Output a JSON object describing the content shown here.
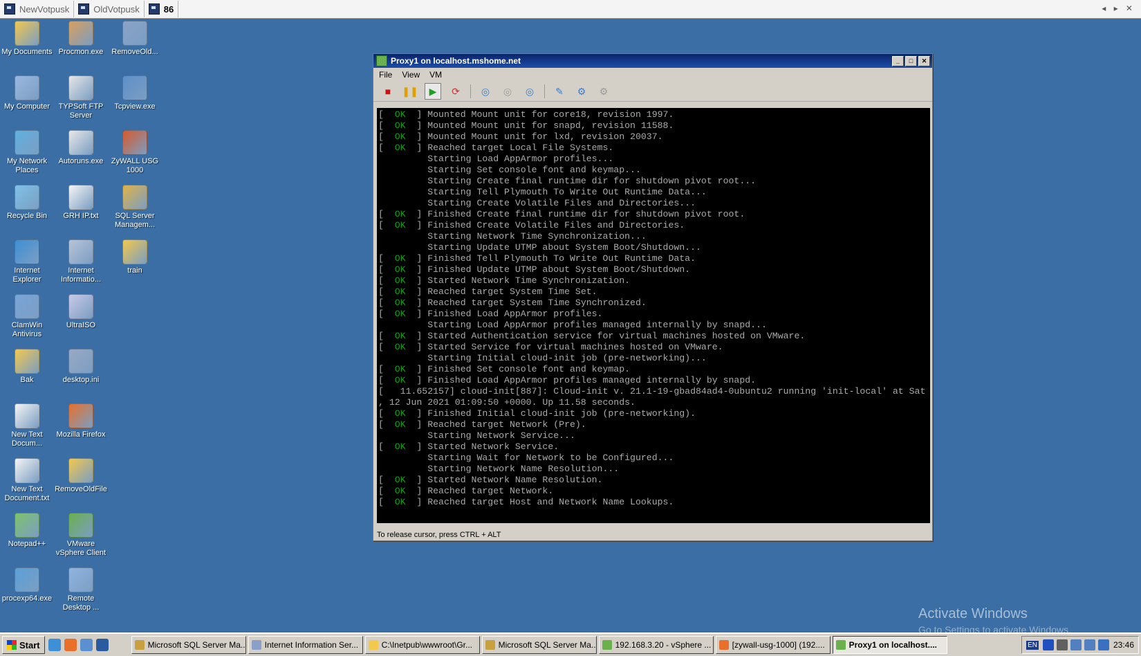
{
  "tabs": [
    {
      "label": "NewVotpusk",
      "active": false
    },
    {
      "label": "OldVotpusk",
      "active": false
    },
    {
      "label": "86",
      "active": true
    }
  ],
  "desktop_icons": [
    {
      "label": "My Documents",
      "icon": "folder-docs-icon",
      "color": "#f2c94c"
    },
    {
      "label": "Procmon.exe",
      "icon": "procmon-icon",
      "color": "#d9a05b"
    },
    {
      "label": "RemoveOld...",
      "icon": "remove-old-icon",
      "color": "#8aa3c8"
    },
    {
      "label": "My Computer",
      "icon": "computer-icon",
      "color": "#9bb7e0"
    },
    {
      "label": "TYPSoft FTP Server",
      "icon": "ftp-icon",
      "color": "#e6e6e6"
    },
    {
      "label": "Tcpview.exe",
      "icon": "tcpview-icon",
      "color": "#5f8fc9"
    },
    {
      "label": "My Network Places",
      "icon": "network-icon",
      "color": "#5fb0e0"
    },
    {
      "label": "Autoruns.exe",
      "icon": "autoruns-icon",
      "color": "#e8e8e8"
    },
    {
      "label": "ZyWALL USG 1000",
      "icon": "firefox-shortcut-icon",
      "color": "#d65a2a"
    },
    {
      "label": "Recycle Bin",
      "icon": "recycle-bin-icon",
      "color": "#7fc2e8"
    },
    {
      "label": "GRH IP.txt",
      "icon": "text-file-icon",
      "color": "#f5f5f5"
    },
    {
      "label": "SQL Server Managem...",
      "icon": "sql-server-icon",
      "color": "#e0b34a"
    },
    {
      "label": "Internet Explorer",
      "icon": "ie-icon",
      "color": "#3d8fd6"
    },
    {
      "label": "Internet Informatio...",
      "icon": "iis-icon",
      "color": "#b8c4d8"
    },
    {
      "label": "train",
      "icon": "folder-icon",
      "color": "#f2c94c"
    },
    {
      "label": "ClamWin Antivirus",
      "icon": "clamwin-icon",
      "color": "#7aa5d8"
    },
    {
      "label": "UltraISO",
      "icon": "ultraiso-icon",
      "color": "#c9c9e8"
    },
    {
      "label": "Bak",
      "icon": "folder-icon",
      "color": "#f2c94c"
    },
    {
      "label": "desktop.ini",
      "icon": "ini-file-icon",
      "color": "#9aa9c4"
    },
    {
      "label": "New Text Docum...",
      "icon": "text-file-icon",
      "color": "#f5f5f5"
    },
    {
      "label": "Mozilla Firefox",
      "icon": "firefox-icon",
      "color": "#e8702a"
    },
    {
      "label": "New Text Document.txt",
      "icon": "text-file-icon",
      "color": "#f5f5f5"
    },
    {
      "label": "RemoveOldFile",
      "icon": "remove-old-file-icon",
      "color": "#f2c94c"
    },
    {
      "label": "Notepad++",
      "icon": "notepadpp-icon",
      "color": "#7ec36a"
    },
    {
      "label": "VMware vSphere Client",
      "icon": "vsphere-icon",
      "color": "#6ab04c"
    },
    {
      "label": "procexp64.exe",
      "icon": "procexp-icon",
      "color": "#5aa0d8"
    },
    {
      "label": "Remote Desktop ...",
      "icon": "remote-desktop-icon",
      "color": "#8fb4e0"
    }
  ],
  "vm_window": {
    "title": "Proxy1 on localhost.mshome.net",
    "menu": [
      "File",
      "View",
      "VM"
    ],
    "toolbar": [
      {
        "name": "power-off-icon",
        "glyph": "■",
        "color": "#d01010"
      },
      {
        "name": "suspend-icon",
        "glyph": "❚❚",
        "color": "#e0a000"
      },
      {
        "name": "power-on-icon",
        "glyph": "▶",
        "color": "#20a020"
      },
      {
        "name": "reset-icon",
        "glyph": "⟳",
        "color": "#d03030"
      },
      {
        "name": "snapshot-icon",
        "glyph": "◎",
        "color": "#3a7fc8"
      },
      {
        "name": "revert-snapshot-icon",
        "glyph": "◎",
        "color": "#9a9a9a"
      },
      {
        "name": "snapshot-manager-icon",
        "glyph": "◎",
        "color": "#3a7fc8"
      },
      {
        "name": "edit-settings-icon",
        "glyph": "✎",
        "color": "#3a7fc8"
      },
      {
        "name": "connect-devices-icon",
        "glyph": "⚙",
        "color": "#3a7fc8"
      },
      {
        "name": "disconnect-devices-icon",
        "glyph": "⚙",
        "color": "#9a9a9a"
      }
    ],
    "status": "To release cursor, press CTRL + ALT"
  },
  "console_lines": [
    {
      "type": "ok",
      "text": "Mounted Mount unit for core18, revision 1997."
    },
    {
      "type": "ok",
      "text": "Mounted Mount unit for snapd, revision 11588."
    },
    {
      "type": "ok",
      "text": "Mounted Mount unit for lxd, revision 20037."
    },
    {
      "type": "ok",
      "text": "Reached target Local File Systems."
    },
    {
      "type": "start",
      "text": "Starting Load AppArmor profiles..."
    },
    {
      "type": "start",
      "text": "Starting Set console font and keymap..."
    },
    {
      "type": "start",
      "text": "Starting Create final runtime dir for shutdown pivot root..."
    },
    {
      "type": "start",
      "text": "Starting Tell Plymouth To Write Out Runtime Data..."
    },
    {
      "type": "start",
      "text": "Starting Create Volatile Files and Directories..."
    },
    {
      "type": "ok",
      "text": "Finished Create final runtime dir for shutdown pivot root."
    },
    {
      "type": "ok",
      "text": "Finished Create Volatile Files and Directories."
    },
    {
      "type": "start",
      "text": "Starting Network Time Synchronization..."
    },
    {
      "type": "start",
      "text": "Starting Update UTMP about System Boot/Shutdown..."
    },
    {
      "type": "ok",
      "text": "Finished Tell Plymouth To Write Out Runtime Data."
    },
    {
      "type": "ok",
      "text": "Finished Update UTMP about System Boot/Shutdown."
    },
    {
      "type": "ok",
      "text": "Started Network Time Synchronization."
    },
    {
      "type": "ok",
      "text": "Reached target System Time Set."
    },
    {
      "type": "ok",
      "text": "Reached target System Time Synchronized."
    },
    {
      "type": "ok",
      "text": "Finished Load AppArmor profiles."
    },
    {
      "type": "start",
      "text": "Starting Load AppArmor profiles managed internally by snapd..."
    },
    {
      "type": "ok",
      "text": "Started Authentication service for virtual machines hosted on VMware."
    },
    {
      "type": "ok",
      "text": "Started Service for virtual machines hosted on VMware."
    },
    {
      "type": "start",
      "text": "Starting Initial cloud-init job (pre-networking)..."
    },
    {
      "type": "ok",
      "text": "Finished Set console font and keymap."
    },
    {
      "type": "ok",
      "text": "Finished Load AppArmor profiles managed internally by snapd."
    },
    {
      "type": "raw",
      "text": "[   11.652157] cloud-init[887]: Cloud-init v. 21.1-19-gbad84ad4-0ubuntu2 running 'init-local' at Sat"
    },
    {
      "type": "raw",
      "text": ", 12 Jun 2021 01:09:50 +0000. Up 11.58 seconds."
    },
    {
      "type": "ok",
      "text": "Finished Initial cloud-init job (pre-networking)."
    },
    {
      "type": "ok",
      "text": "Reached target Network (Pre)."
    },
    {
      "type": "start",
      "text": "Starting Network Service..."
    },
    {
      "type": "ok",
      "text": "Started Network Service."
    },
    {
      "type": "start",
      "text": "Starting Wait for Network to be Configured..."
    },
    {
      "type": "start",
      "text": "Starting Network Name Resolution..."
    },
    {
      "type": "ok",
      "text": "Started Network Name Resolution."
    },
    {
      "type": "ok",
      "text": "Reached target Network."
    },
    {
      "type": "ok",
      "text": "Reached target Host and Network Name Lookups."
    },
    {
      "type": "raw",
      "text": ""
    },
    {
      "type": "raw",
      "text": "_"
    }
  ],
  "watermark": {
    "line1": "Activate Windows",
    "line2": "Go to Settings to activate Windows."
  },
  "taskbar": {
    "start_label": "Start",
    "quicklaunch": [
      {
        "name": "ie-quicklaunch-icon",
        "color": "#3d8fd6"
      },
      {
        "name": "firefox-quicklaunch-icon",
        "color": "#e8702a"
      },
      {
        "name": "explorer-quicklaunch-icon",
        "color": "#5a8fd0"
      },
      {
        "name": "procexp-quicklaunch-icon",
        "color": "#2a5aa0"
      }
    ],
    "items": [
      {
        "label": "Microsoft SQL Server Ma...",
        "color": "#c8a040",
        "active": false
      },
      {
        "label": "Internet Information Ser...",
        "color": "#8aa0c8",
        "active": false
      },
      {
        "label": "C:\\Inetpub\\wwwroot\\Gr...",
        "color": "#f2c94c",
        "active": false
      },
      {
        "label": "Microsoft SQL Server Ma...",
        "color": "#c8a040",
        "active": false
      },
      {
        "label": "192.168.3.20 - vSphere ...",
        "color": "#6ab04c",
        "active": false
      },
      {
        "label": "[zywall-usg-1000] (192....",
        "color": "#e8702a",
        "active": false
      },
      {
        "label": "Proxy1 on localhost....",
        "color": "#6ab04c",
        "active": true
      }
    ],
    "tray": {
      "lang": "EN",
      "clock": "23:46",
      "icons": [
        {
          "name": "help-tray-icon",
          "color": "#2050c0"
        },
        {
          "name": "battery-tray-icon",
          "color": "#606060"
        },
        {
          "name": "network-tray-icon",
          "color": "#5080c0"
        },
        {
          "name": "network2-tray-icon",
          "color": "#5080c0"
        },
        {
          "name": "globe-tray-icon",
          "color": "#3a70c0"
        }
      ]
    }
  }
}
